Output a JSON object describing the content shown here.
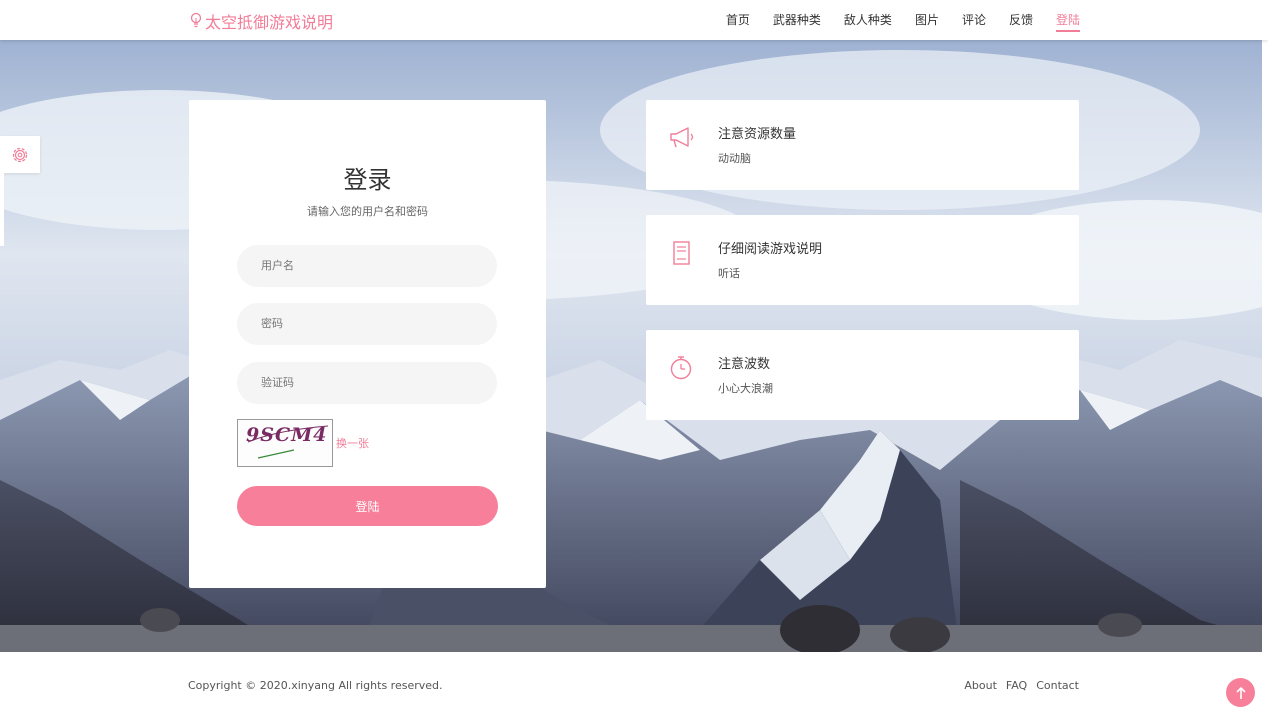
{
  "header": {
    "brand": "太空抵御游戏说明",
    "nav": [
      {
        "label": "首页",
        "active": false
      },
      {
        "label": "武器种类",
        "active": false
      },
      {
        "label": "敌人种类",
        "active": false
      },
      {
        "label": "图片",
        "active": false
      },
      {
        "label": "评论",
        "active": false
      },
      {
        "label": "反馈",
        "active": false
      },
      {
        "label": "登陆",
        "active": true
      }
    ]
  },
  "login": {
    "title": "登录",
    "subtitle": "请输入您的用户名和密码",
    "username_placeholder": "用户名",
    "password_placeholder": "密码",
    "captcha_placeholder": "验证码",
    "captcha_code": "9SCM4",
    "refresh_label": "换一张",
    "submit_label": "登陆"
  },
  "info_cards": [
    {
      "title": "注意资源数量",
      "desc": "动动脑",
      "icon": "megaphone-icon"
    },
    {
      "title": "仔细阅读游戏说明",
      "desc": "听话",
      "icon": "book-icon"
    },
    {
      "title": "注意波数",
      "desc": "小心大浪潮",
      "icon": "timer-icon"
    }
  ],
  "footer": {
    "copyright": "Copyright © 2020.xinyang All rights reserved.",
    "links": [
      "About",
      "FAQ",
      "Contact"
    ]
  },
  "colors": {
    "accent": "#f77f9a",
    "brand": "#f27d98"
  },
  "icons": {
    "settings": "gear-icon",
    "back_to_top": "arrow-up-icon",
    "brand": "lightbulb-icon"
  }
}
